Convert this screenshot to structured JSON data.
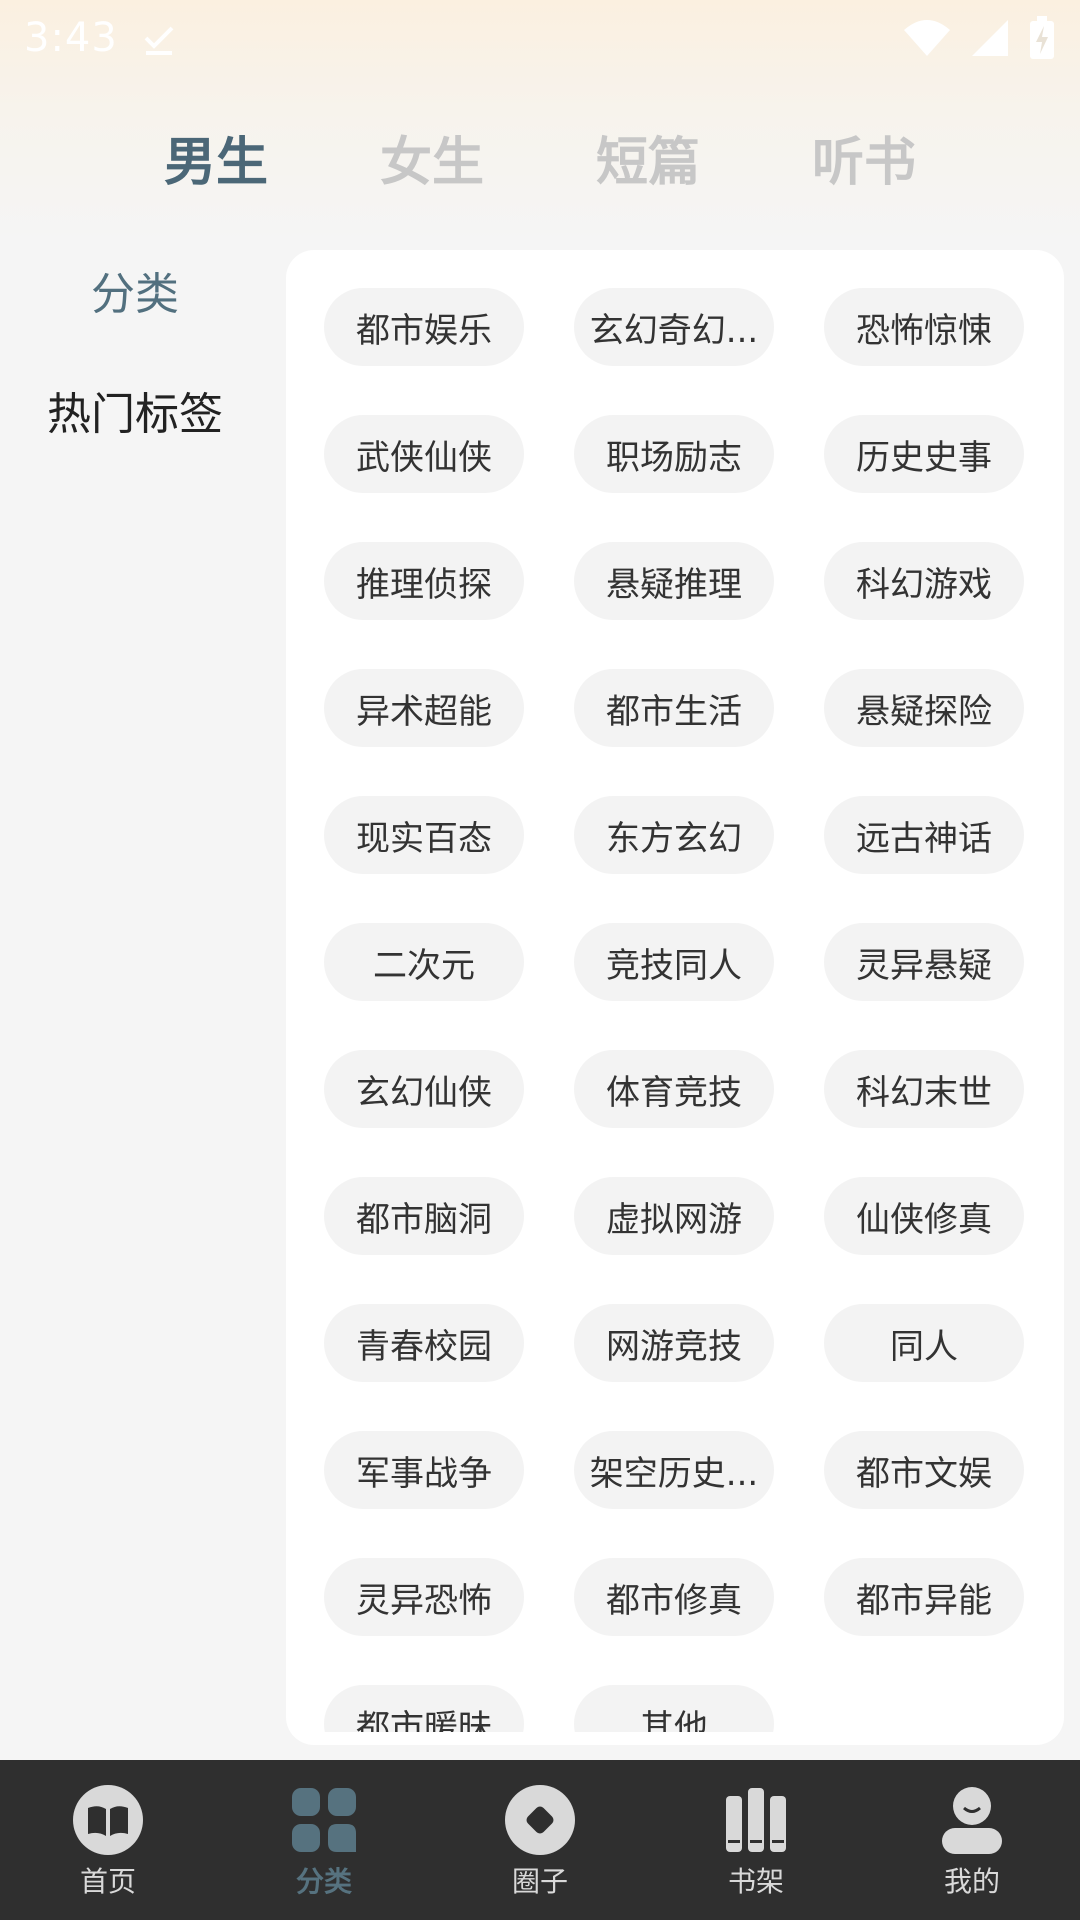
{
  "status": {
    "time": "3:43"
  },
  "top_tabs": [
    {
      "label": "男生",
      "active": true
    },
    {
      "label": "女生",
      "active": false
    },
    {
      "label": "短篇",
      "active": false
    },
    {
      "label": "听书",
      "active": false
    }
  ],
  "side_nav": [
    {
      "label": "分类",
      "active": true
    },
    {
      "label": "热门标签",
      "active": false
    }
  ],
  "tags": [
    "都市娱乐",
    "玄幻奇幻...",
    "恐怖惊悚",
    "武侠仙侠",
    "职场励志",
    "历史史事",
    "推理侦探",
    "悬疑推理",
    "科幻游戏",
    "异术超能",
    "都市生活",
    "悬疑探险",
    "现实百态",
    "东方玄幻",
    "远古神话",
    "二次元",
    "竞技同人",
    "灵异悬疑",
    "玄幻仙侠",
    "体育竞技",
    "科幻末世",
    "都市脑洞",
    "虚拟网游",
    "仙侠修真",
    "青春校园",
    "网游竞技",
    "同人",
    "军事战争",
    "架空历史...",
    "都市文娱",
    "灵异恐怖",
    "都市修真",
    "都市异能",
    "都市暖昧",
    "其他"
  ],
  "bottom_nav": [
    {
      "label": "首页",
      "icon": "book-icon",
      "active": false
    },
    {
      "label": "分类",
      "icon": "grid-icon",
      "active": true
    },
    {
      "label": "圈子",
      "icon": "circle-icon",
      "active": false
    },
    {
      "label": "书架",
      "icon": "bookshelf-icon",
      "active": false
    },
    {
      "label": "我的",
      "icon": "user-icon",
      "active": false
    }
  ],
  "colors": {
    "accent": "#4b6777",
    "tab_inactive": "#c7c7c7",
    "nav_bg": "#2f2f2f",
    "tag_bg": "#f3f3f3"
  }
}
